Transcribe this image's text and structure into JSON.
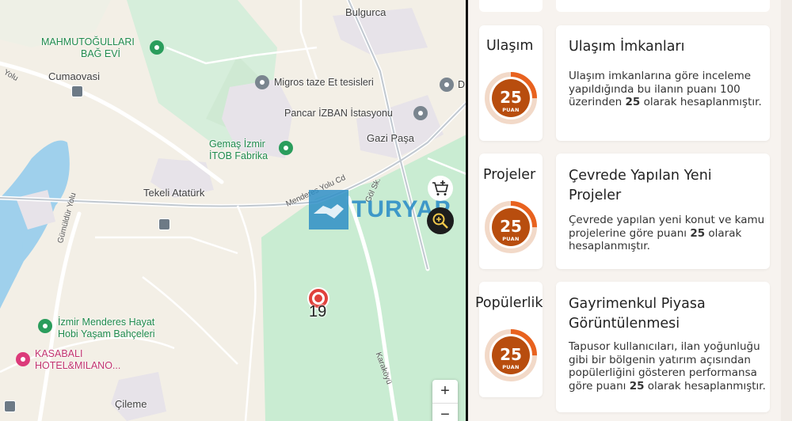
{
  "map": {
    "places": {
      "bulgurca": "Bulgurca",
      "mahmutogullari_1": "MAHMUTOĞULLARI",
      "mahmutogullari_2": "BAĞ EVİ",
      "cumaovasi": "Cumaovasi",
      "migros": "Migros taze Et tesisleri",
      "pancar": "Pancar İZBAN İstasyonu",
      "gazi_pasa": "Gazi Paşa",
      "gemas_1": "Gemaş İzmir",
      "gemas_2": "İTOB Fabrika",
      "tekeli": "Tekeli Atatürk",
      "menderes_1": "İzmir Menderes Hayat",
      "menderes_2": "Hobi Yaşam Bahçeleri",
      "kasabali_1": "KASABALI",
      "kasabali_2": "HOTEL&MILANO...",
      "cileme": "Çileme",
      "d_label": "D"
    },
    "roads": {
      "menderes_yolu": "Menderes Yolu Cd",
      "gol_sk": "Göl Sk.",
      "karakoyu": "Karaköyü",
      "gumuldur": "Gümüldür Yolu",
      "yolu": "Yolu"
    },
    "marker_number": "19",
    "watermark": "TURYAP",
    "zoom_in": "+",
    "zoom_out": "−",
    "icons": [
      "cart-add-icon",
      "zoom-in-icon"
    ]
  },
  "panel": {
    "cards": [
      {
        "category": "Ulaşım",
        "title": "Ulaşım İmkanları",
        "score": "25",
        "score_unit": "PUAN",
        "score_value": 25,
        "score_max": 100,
        "desc_before": "Ulaşım imkanlarına göre inceleme yapıldığında bu ilanın puanı 100 üzerinden ",
        "desc_bold": "25",
        "desc_after": " olarak hesaplanmıştır."
      },
      {
        "category": "Projeler",
        "title": "Çevrede Yapılan Yeni Projeler",
        "score": "25",
        "score_unit": "PUAN",
        "score_value": 25,
        "score_max": 100,
        "desc_before": "Çevrede yapılan yeni konut ve kamu projelerine göre puanı ",
        "desc_bold": "25",
        "desc_after": " olarak hesaplanmıştır."
      },
      {
        "category": "Popülerlik",
        "title": "Gayrimenkul Piyasa Görüntülenmesi",
        "score": "25",
        "score_unit": "PUAN",
        "score_value": 25,
        "score_max": 100,
        "desc_before": "Tapusor kullanıcıları, ilan yoğunluğu gibi bir bölgenin yatırım açısından popülerliğini gösteren performansa göre puanı ",
        "desc_bold": "25",
        "desc_after": " olarak hesaplanmıştır."
      }
    ],
    "colors": {
      "gauge_fill": "#b84d0e",
      "gauge_progress": "#e8621f",
      "gauge_track": "#f2d9c8"
    }
  }
}
